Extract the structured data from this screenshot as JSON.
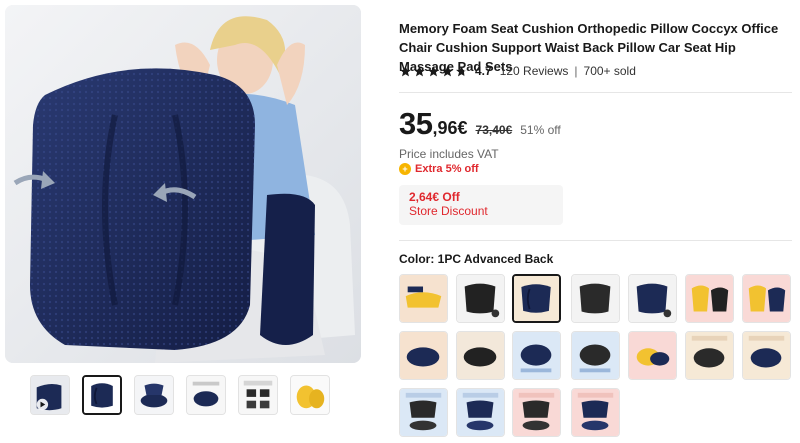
{
  "product": {
    "title": "Memory Foam Seat Cushion Orthopedic Pillow Coccyx Office Chair Cushion Support Waist Back Pillow Car Seat Hip Massage Pad Sets",
    "rating": "4.7",
    "rating_fraction": 0.94,
    "reviews": "120 Reviews",
    "separator": "|",
    "sold": "700+ sold"
  },
  "price": {
    "integer": "35",
    "decimal": ",96€",
    "original": "73,40€",
    "discount": "51% off",
    "vat": "Price includes VAT",
    "extra_icon_glyph": "+",
    "extra": "Extra 5% off"
  },
  "store_discount": {
    "amount": "2,64€ Off",
    "label": "Store Discount"
  },
  "color": {
    "label": "Color: 1PC Advanced Back"
  },
  "icons": {
    "star": "star-icon",
    "play": "play-icon",
    "coin": "coin-icon"
  },
  "colors": {
    "accent_red": "#e0282e",
    "navy": "#1c2a55",
    "coin": "#f7b500"
  }
}
